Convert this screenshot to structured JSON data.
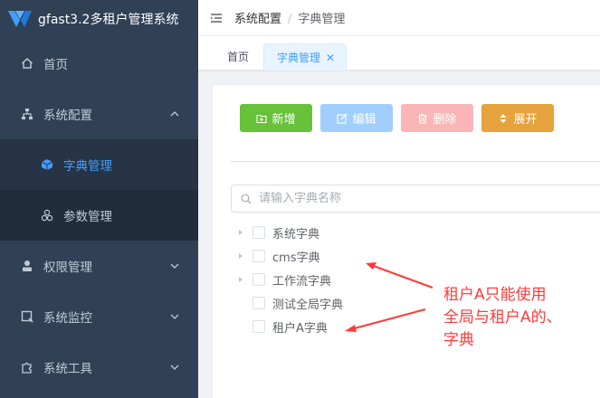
{
  "brand": {
    "title": "gfast3.2多租户管理系统"
  },
  "sidebar": {
    "items": [
      {
        "label": "首页",
        "icon": "home-icon"
      },
      {
        "label": "系统配置",
        "icon": "sitemap-icon",
        "expanded": true,
        "children": [
          {
            "label": "字典管理",
            "icon": "cube-icon",
            "active": true
          },
          {
            "label": "参数管理",
            "icon": "cubes-icon"
          }
        ]
      },
      {
        "label": "权限管理",
        "icon": "user-icon"
      },
      {
        "label": "系统监控",
        "icon": "monitor-icon"
      },
      {
        "label": "系统工具",
        "icon": "puzzle-icon"
      }
    ]
  },
  "navbar": {
    "breadcrumb": [
      "系统配置",
      "字典管理"
    ]
  },
  "tags": {
    "home": "首页",
    "active": "字典管理"
  },
  "toolbar": {
    "add": "新增",
    "edit": "编辑",
    "delete": "删除",
    "expand": "展开"
  },
  "search": {
    "placeholder": "请输入字典名称"
  },
  "tree": {
    "nodes": [
      {
        "label": "系统字典",
        "has_children": true
      },
      {
        "label": "cms字典",
        "has_children": true
      },
      {
        "label": "工作流字典",
        "has_children": true
      },
      {
        "label": "测试全局字典",
        "has_children": false
      },
      {
        "label": "租户A字典",
        "has_children": false
      }
    ]
  },
  "annotation": {
    "lines": [
      "租户A只能使用",
      "全局与租户A的、",
      "字典"
    ],
    "color": "#ff3b3b"
  },
  "colors": {
    "sidebar_bg": "#304156",
    "accent": "#409eff",
    "success": "#67c23a",
    "warning": "#e6a23c",
    "danger_light": "#fab6b6",
    "primary_light": "#a0cfff"
  }
}
